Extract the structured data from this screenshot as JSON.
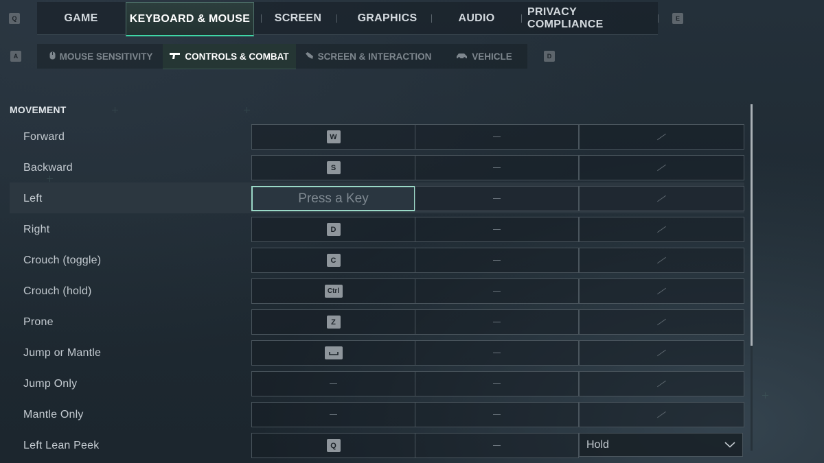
{
  "top_nav": {
    "left_key": "Q",
    "right_key": "E",
    "tabs": [
      "GAME",
      "KEYBOARD & MOUSE",
      "SCREEN",
      "GRAPHICS",
      "AUDIO",
      "PRIVACY COMPLIANCE"
    ],
    "active": "KEYBOARD & MOUSE"
  },
  "sub_nav": {
    "left_key": "A",
    "right_key": "D",
    "tabs": [
      {
        "label": "MOUSE SENSITIVITY",
        "icon": "mouse-icon"
      },
      {
        "label": "CONTROLS & COMBAT",
        "icon": "gun-icon"
      },
      {
        "label": "SCREEN & INTERACTION",
        "icon": "hand-icon"
      },
      {
        "label": "VEHICLE",
        "icon": "vehicle-icon"
      }
    ],
    "active": "CONTROLS & COMBAT"
  },
  "section": {
    "title": "MOVEMENT"
  },
  "bindings": [
    {
      "label": "Forward",
      "primary": "W",
      "secondary": "—",
      "third": ""
    },
    {
      "label": "Backward",
      "primary": "S",
      "secondary": "—",
      "third": ""
    },
    {
      "label": "Left",
      "primary": "Press a Key",
      "secondary": "—",
      "third": ""
    },
    {
      "label": "Right",
      "primary": "D",
      "secondary": "—",
      "third": ""
    },
    {
      "label": "Crouch (toggle)",
      "primary": "C",
      "secondary": "—",
      "third": ""
    },
    {
      "label": "Crouch (hold)",
      "primary": "Ctrl",
      "secondary": "—",
      "third": ""
    },
    {
      "label": "Prone",
      "primary": "Z",
      "secondary": "—",
      "third": ""
    },
    {
      "label": "Jump or Mantle",
      "primary": "space-key-icon",
      "secondary": "—",
      "third": ""
    },
    {
      "label": "Jump Only",
      "primary": "—",
      "secondary": "—",
      "third": ""
    },
    {
      "label": "Mantle Only",
      "primary": "—",
      "secondary": "—",
      "third": ""
    },
    {
      "label": "Left Lean Peek",
      "primary": "Q",
      "secondary": "—",
      "third": "Hold"
    }
  ],
  "colors": {
    "accent": "#3fd6a6",
    "active_input_border": "#9ad9c7"
  }
}
